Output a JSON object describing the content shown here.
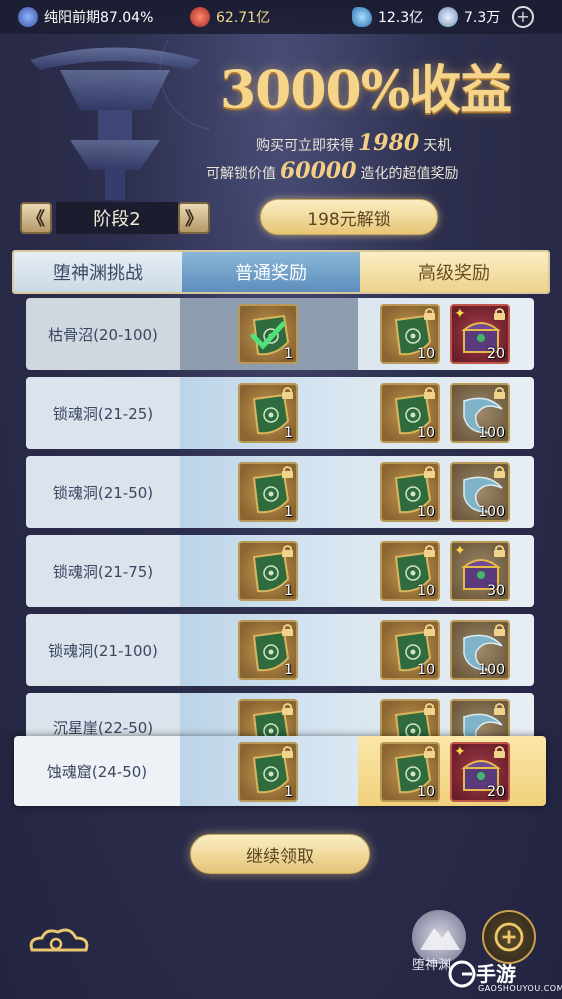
{
  "status_bar": {
    "realm": "纯阳前期87.04%",
    "power": "62.71亿",
    "spirit_stone": "12.3亿",
    "jade": "7.3万"
  },
  "banner": {
    "title": "3000%收益",
    "line1_pre": "购买可立即获得",
    "line1_num": "1980",
    "line1_post": "天机",
    "line2_pre": "可解锁价值",
    "line2_num": "60000",
    "line2_post": "造化的超值奖励"
  },
  "stage": {
    "label": "阶段2",
    "prev": "《",
    "next": "》"
  },
  "unlock_button": "198元解锁",
  "table_header": {
    "challenge": "堕神渊挑战",
    "normal": "普通奖励",
    "advanced": "高级奖励"
  },
  "rows": [
    {
      "name": "枯骨沼(20-100)",
      "normal_count": "1",
      "adv1_count": "10",
      "adv2_count": "20"
    },
    {
      "name": "锁魂洞(21-25)",
      "normal_count": "1",
      "adv1_count": "10",
      "adv2_count": "100"
    },
    {
      "name": "锁魂洞(21-50)",
      "normal_count": "1",
      "adv1_count": "10",
      "adv2_count": "100"
    },
    {
      "name": "锁魂洞(21-75)",
      "normal_count": "1",
      "adv1_count": "10",
      "adv2_count": "30"
    },
    {
      "name": "锁魂洞(21-100)",
      "normal_count": "1",
      "adv1_count": "10",
      "adv2_count": "100"
    },
    {
      "name": "沉星崖(22-50)",
      "normal_count": "",
      "adv1_count": "",
      "adv2_count": ""
    },
    {
      "name": "蚀魂窟(24-50)",
      "normal_count": "1",
      "adv1_count": "10",
      "adv2_count": "20"
    }
  ],
  "continue_button": "继续领取",
  "side_button_label": "堕神渊",
  "watermark": {
    "main": "手游",
    "sub": "GAOSHOUYOU.COM"
  }
}
